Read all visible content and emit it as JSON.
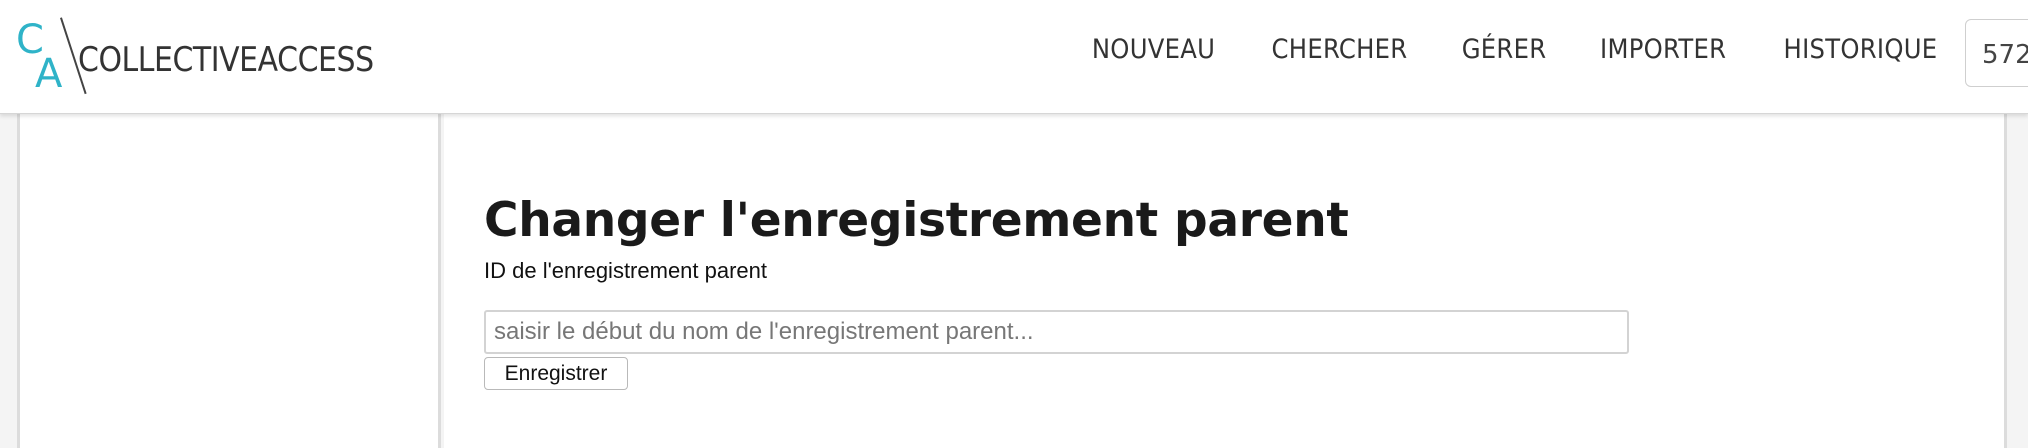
{
  "header": {
    "logo": {
      "mark_top": "C",
      "mark_bottom": "A",
      "name": "COLLECTIVEACCESS"
    },
    "nav": [
      {
        "label": "NOUVEAU"
      },
      {
        "label": "CHERCHER"
      },
      {
        "label": "GÉRER"
      },
      {
        "label": "IMPORTER"
      },
      {
        "label": "HISTORIQUE"
      }
    ],
    "quick_field_value": "572"
  },
  "main": {
    "title": "Changer l'enregistrement parent",
    "field_label": "ID de l'enregistrement parent",
    "input": {
      "value": "",
      "placeholder": "saisir le début du nom de l'enregistrement parent..."
    },
    "save_label": "Enregistrer"
  },
  "colors": {
    "logo_accent": "#2fb3c8",
    "text": "#333333",
    "border": "#dcdcdc",
    "background": "#f4f4f4"
  }
}
